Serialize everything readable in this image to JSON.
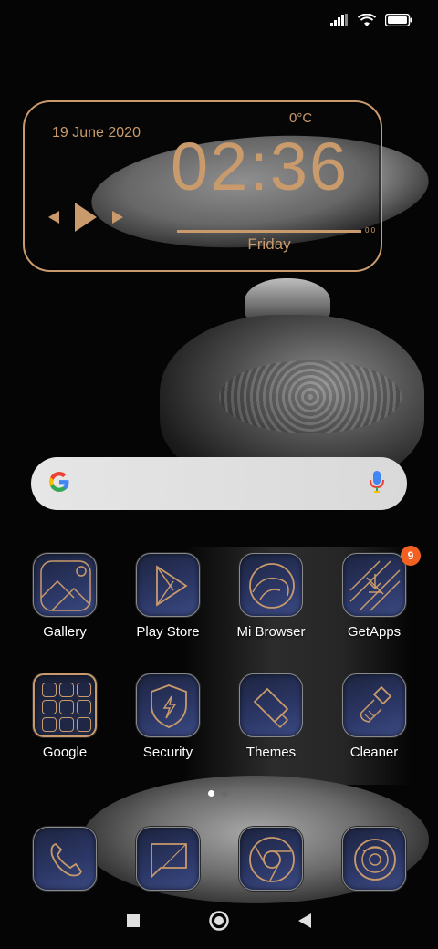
{
  "colors": {
    "accent": "#c99a6b",
    "icon_bg": "#2b3664",
    "badge": "#f26122",
    "label": "#ffffff"
  },
  "status_bar": {
    "icons": [
      "signal-icon",
      "wifi-icon",
      "battery-icon"
    ]
  },
  "widget": {
    "date": "19 June 2020",
    "temperature": "0°C",
    "time": "02:36",
    "day": "Friday",
    "progress_time": "0:0",
    "progress_fraction": 1.0,
    "controls": [
      "previous-icon",
      "play-icon",
      "next-icon"
    ]
  },
  "search": {
    "icons": [
      "google-g-icon",
      "microphone-icon"
    ]
  },
  "apps_row1": [
    {
      "label": "Gallery",
      "icon": "gallery-icon"
    },
    {
      "label": "Play Store",
      "icon": "play-store-icon"
    },
    {
      "label": "Mi Browser",
      "icon": "mi-browser-icon"
    },
    {
      "label": "GetApps",
      "icon": "getapps-icon",
      "badge": "9"
    }
  ],
  "apps_row2": [
    {
      "label": "Google",
      "icon": "google-folder-icon"
    },
    {
      "label": "Security",
      "icon": "security-icon"
    },
    {
      "label": "Themes",
      "icon": "themes-icon"
    },
    {
      "label": "Cleaner",
      "icon": "cleaner-icon"
    }
  ],
  "page_indicator": {
    "pages": 2,
    "active": 1
  },
  "dock": [
    {
      "icon": "phone-icon"
    },
    {
      "icon": "messages-icon"
    },
    {
      "icon": "chrome-icon"
    },
    {
      "icon": "camera-icon"
    }
  ],
  "nav_bar": {
    "buttons": [
      "recents-button",
      "home-button",
      "back-button"
    ]
  }
}
